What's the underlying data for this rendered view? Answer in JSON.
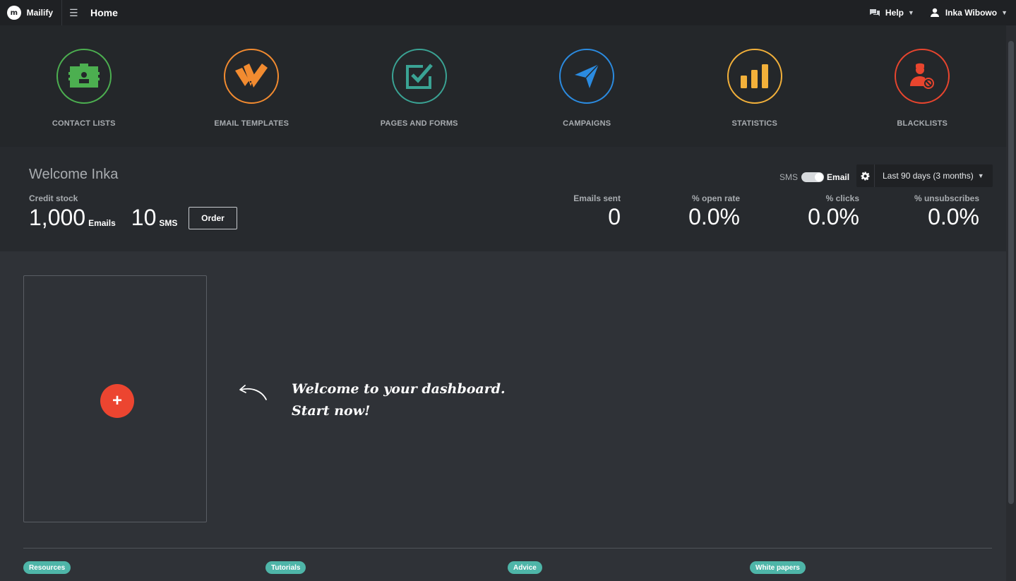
{
  "topbar": {
    "brand": "Mailify",
    "brand_logo": "m",
    "page_title": "Home",
    "help_label": "Help",
    "user_name": "Inka Wibowo"
  },
  "modules": [
    {
      "label": "CONTACT LISTS",
      "color": "#4caf50",
      "icon": "contact-card-icon"
    },
    {
      "label": "EMAIL TEMPLATES",
      "color": "#f28b30",
      "icon": "templates-icon"
    },
    {
      "label": "PAGES AND FORMS",
      "color": "#3aa394",
      "icon": "checkbox-icon"
    },
    {
      "label": "CAMPAIGNS",
      "color": "#2b8be0",
      "icon": "paper-plane-icon"
    },
    {
      "label": "STATISTICS",
      "color": "#f2b03a",
      "icon": "bar-chart-icon"
    },
    {
      "label": "BLACKLISTS",
      "color": "#e8452e",
      "icon": "blocked-user-icon"
    }
  ],
  "stats": {
    "welcome": "Welcome Inka",
    "credit_label": "Credit stock",
    "emails_credit": "1,000",
    "emails_unit": "Emails",
    "sms_credit": "10",
    "sms_unit": "SMS",
    "order_label": "Order",
    "toggle_sms": "SMS",
    "toggle_email": "Email",
    "period": "Last 90 days (3 months)",
    "metrics": [
      {
        "label": "Emails sent",
        "value": "0"
      },
      {
        "label": "% open rate",
        "value": "0.0%"
      },
      {
        "label": "% clicks",
        "value": "0.0%"
      },
      {
        "label": "% unsubscribes",
        "value": "0.0%"
      }
    ]
  },
  "dashboard": {
    "add_label": "+",
    "hint_line1": "Welcome to your dashboard.",
    "hint_line2": "Start now!"
  },
  "tags": [
    "Resources",
    "Tutorials",
    "Advice",
    "White papers"
  ]
}
